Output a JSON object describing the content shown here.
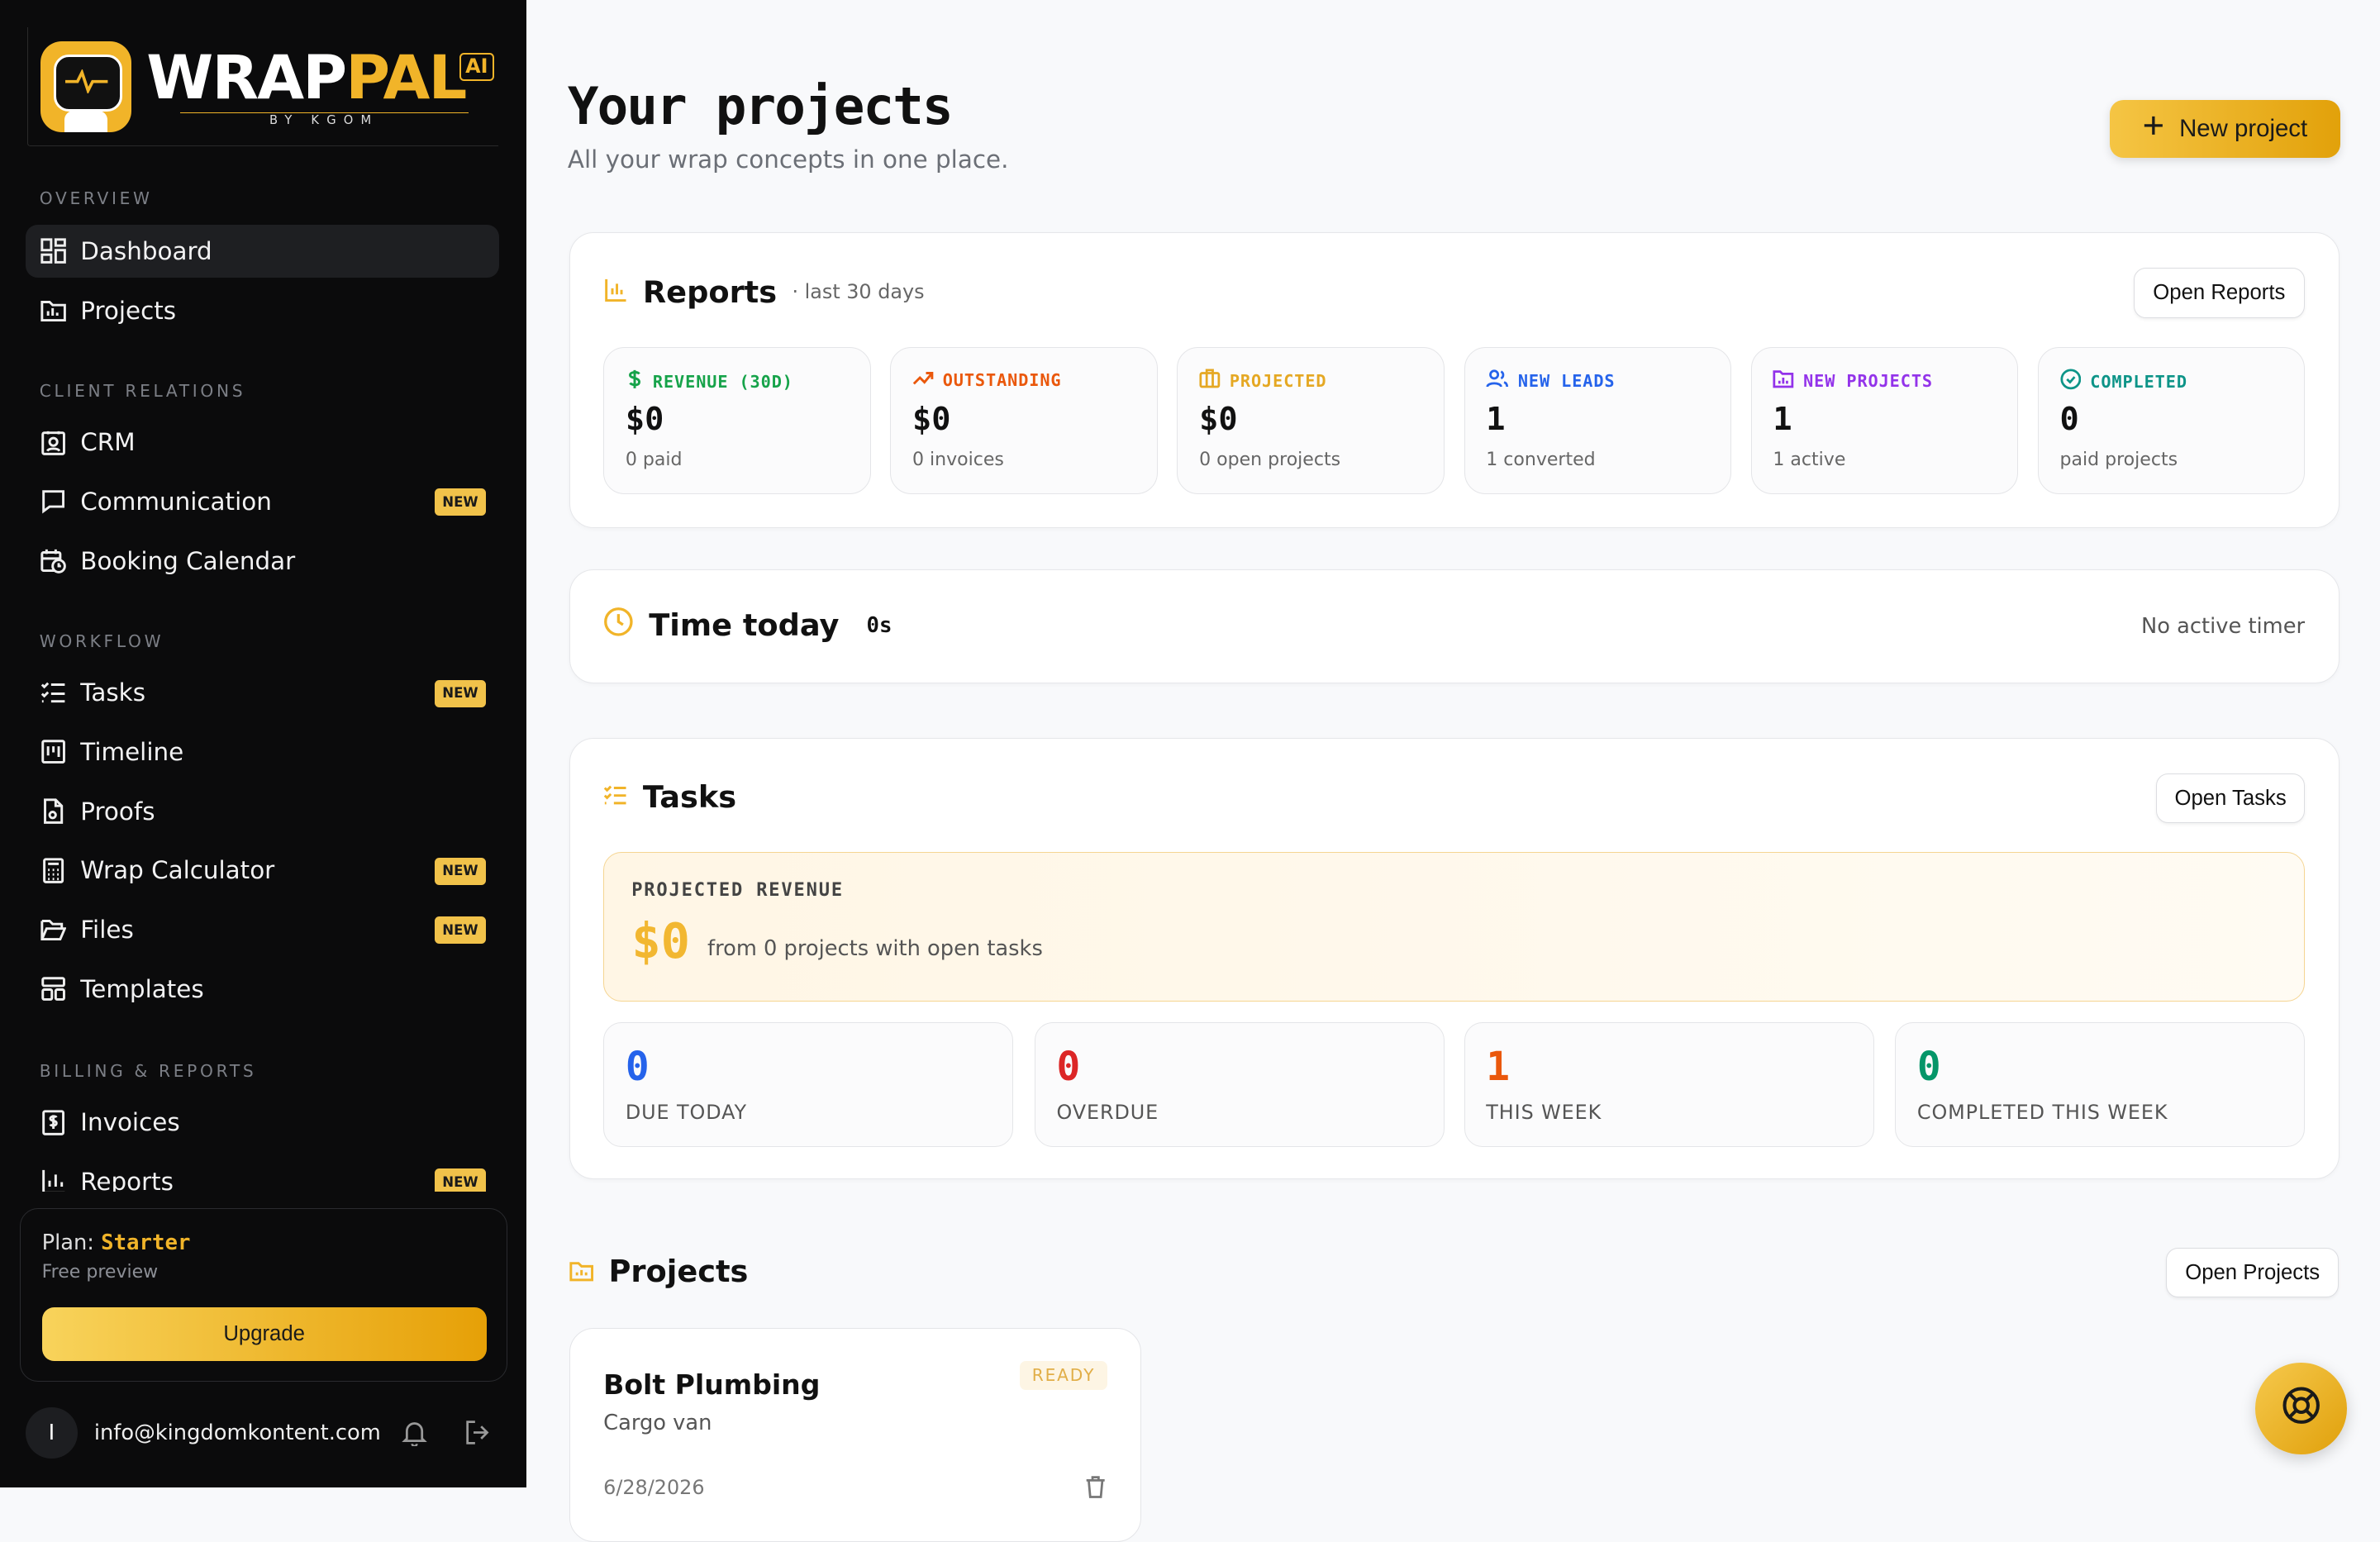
{
  "brand": {
    "word1": "WRAP",
    "word2": "PAL",
    "ai": "AI",
    "byline": "BY KGOM"
  },
  "sidebar": {
    "sections": [
      {
        "label": "OVERVIEW"
      },
      {
        "label": "CLIENT RELATIONS"
      },
      {
        "label": "WORKFLOW"
      },
      {
        "label": "BILLING & REPORTS"
      }
    ],
    "items": [
      {
        "label": "Dashboard",
        "icon": "dashboard-icon",
        "active": true
      },
      {
        "label": "Projects",
        "icon": "folder-chart-icon"
      },
      {
        "label": "CRM",
        "icon": "contact-icon"
      },
      {
        "label": "Communication",
        "icon": "chat-icon",
        "badge": "NEW"
      },
      {
        "label": "Booking Calendar",
        "icon": "calendar-clock-icon"
      },
      {
        "label": "Tasks",
        "icon": "checklist-icon",
        "badge": "NEW"
      },
      {
        "label": "Timeline",
        "icon": "timeline-icon"
      },
      {
        "label": "Proofs",
        "icon": "file-icon"
      },
      {
        "label": "Wrap Calculator",
        "icon": "calculator-icon",
        "badge": "NEW"
      },
      {
        "label": "Files",
        "icon": "folder-open-icon",
        "badge": "NEW"
      },
      {
        "label": "Templates",
        "icon": "template-icon"
      },
      {
        "label": "Invoices",
        "icon": "invoice-icon"
      },
      {
        "label": "Reports",
        "icon": "bar-chart-icon",
        "badge": "NEW"
      }
    ],
    "plan": {
      "prefix": "Plan:",
      "name": "Starter",
      "sub": "Free preview",
      "upgrade": "Upgrade"
    },
    "user": {
      "initial": "I",
      "email": "info@kingdomkontent.com"
    }
  },
  "header": {
    "title": "Your projects",
    "subtitle": "All your wrap concepts in one place.",
    "new_project": "New project"
  },
  "reports": {
    "title": "Reports",
    "range": "· last 30 days",
    "open": "Open Reports",
    "stats": [
      {
        "label": "REVENUE (30D)",
        "value": "$0",
        "note": "0 paid",
        "color": "#16a34a",
        "icon": "dollar-icon"
      },
      {
        "label": "OUTSTANDING",
        "value": "$0",
        "note": "0 invoices",
        "color": "#ea580c",
        "icon": "trend-up-icon"
      },
      {
        "label": "PROJECTED",
        "value": "$0",
        "note": "0 open projects",
        "color": "#e5a823",
        "icon": "briefcase-icon"
      },
      {
        "label": "NEW LEADS",
        "value": "1",
        "note": "1 converted",
        "color": "#2563eb",
        "icon": "users-icon"
      },
      {
        "label": "NEW PROJECTS",
        "value": "1",
        "note": "1 active",
        "color": "#9333ea",
        "icon": "folder-chart-icon"
      },
      {
        "label": "COMPLETED",
        "value": "0",
        "note": "paid projects",
        "color": "#0d9488",
        "icon": "check-circle-icon"
      }
    ]
  },
  "time_today": {
    "title": "Time today",
    "value": "0s",
    "status": "No active timer"
  },
  "tasks": {
    "title": "Tasks",
    "open": "Open Tasks",
    "projected_label": "PROJECTED REVENUE",
    "projected_value": "$0",
    "projected_note": "from 0 projects with open tasks",
    "stats": [
      {
        "value": "0",
        "label": "DUE TODAY",
        "color": "#2563eb"
      },
      {
        "value": "0",
        "label": "OVERDUE",
        "color": "#dc2626"
      },
      {
        "value": "1",
        "label": "THIS WEEK",
        "color": "#ea580c"
      },
      {
        "value": "0",
        "label": "COMPLETED THIS WEEK",
        "color": "#059669"
      }
    ]
  },
  "projects": {
    "title": "Projects",
    "open": "Open Projects",
    "items": [
      {
        "name": "Bolt Plumbing",
        "type": "Cargo van",
        "status": "READY",
        "date": "6/28/2026"
      }
    ]
  },
  "accent": "#f1b429"
}
